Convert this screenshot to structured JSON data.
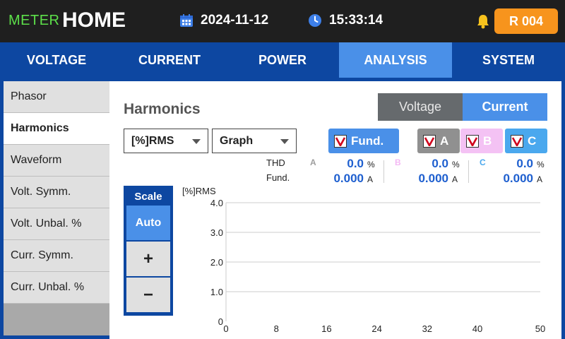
{
  "header": {
    "brand_sub": "METER",
    "brand_main": "HOME",
    "date": "2024-11-12",
    "time": "15:33:14",
    "record_label": "R 004",
    "colors": {
      "background": "#1f1f1f",
      "brand_sub": "#5de04a",
      "record": "#f7941d"
    }
  },
  "nav": {
    "tabs": [
      {
        "label": "VOLTAGE",
        "active": false
      },
      {
        "label": "CURRENT",
        "active": false
      },
      {
        "label": "POWER",
        "active": false
      },
      {
        "label": "ANALYSIS",
        "active": true
      },
      {
        "label": "SYSTEM",
        "active": false
      }
    ],
    "colors": {
      "bar": "#0d47a1",
      "active": "#4a90e8"
    }
  },
  "sidebar": {
    "items": [
      {
        "label": "Phasor",
        "active": false
      },
      {
        "label": "Harmonics",
        "active": true
      },
      {
        "label": "Waveform",
        "active": false
      },
      {
        "label": "Volt. Symm.",
        "active": false
      },
      {
        "label": "Volt. Unbal. %",
        "active": false
      },
      {
        "label": "Curr. Symm.",
        "active": false
      },
      {
        "label": "Curr. Unbal. %",
        "active": false
      }
    ]
  },
  "main": {
    "title": "Harmonics",
    "segment": {
      "voltage": "Voltage",
      "current": "Current",
      "selected": "Current"
    },
    "unit_dropdown": "[%]RMS",
    "mode_dropdown": "Graph",
    "checks": {
      "fund": {
        "label": "Fund.",
        "checked": true
      },
      "a": {
        "label": "A",
        "checked": true
      },
      "b": {
        "label": "B",
        "checked": true
      },
      "c": {
        "label": "C",
        "checked": true
      }
    },
    "readings": {
      "thd_label": "THD",
      "fund_label": "Fund.",
      "phases": [
        {
          "letter": "A",
          "color": "#9e9e9e",
          "thd": "0.0",
          "thd_unit": "%",
          "fund": "0.000",
          "fund_unit": "A"
        },
        {
          "letter": "B",
          "color": "#f4b8f4",
          "thd": "0.0",
          "thd_unit": "%",
          "fund": "0.000",
          "fund_unit": "A"
        },
        {
          "letter": "C",
          "color": "#4aa8ee",
          "thd": "0.0",
          "thd_unit": "%",
          "fund": "0.000",
          "fund_unit": "A"
        }
      ]
    },
    "scale": {
      "title": "Scale",
      "auto": "Auto",
      "plus": "+",
      "minus": "−"
    }
  },
  "chart_data": {
    "type": "bar",
    "title": "",
    "ylabel": "[%]RMS",
    "xlabel": "",
    "x_ticks": [
      0,
      8,
      16,
      24,
      32,
      40,
      50
    ],
    "y_ticks": [
      0,
      1.0,
      2.0,
      3.0,
      4.0
    ],
    "y_tick_labels": [
      "0",
      "1.0",
      "2.0",
      "3.0",
      "4.0"
    ],
    "xlim": [
      0,
      50
    ],
    "ylim": [
      0,
      4.0
    ],
    "grid": true,
    "series": []
  }
}
